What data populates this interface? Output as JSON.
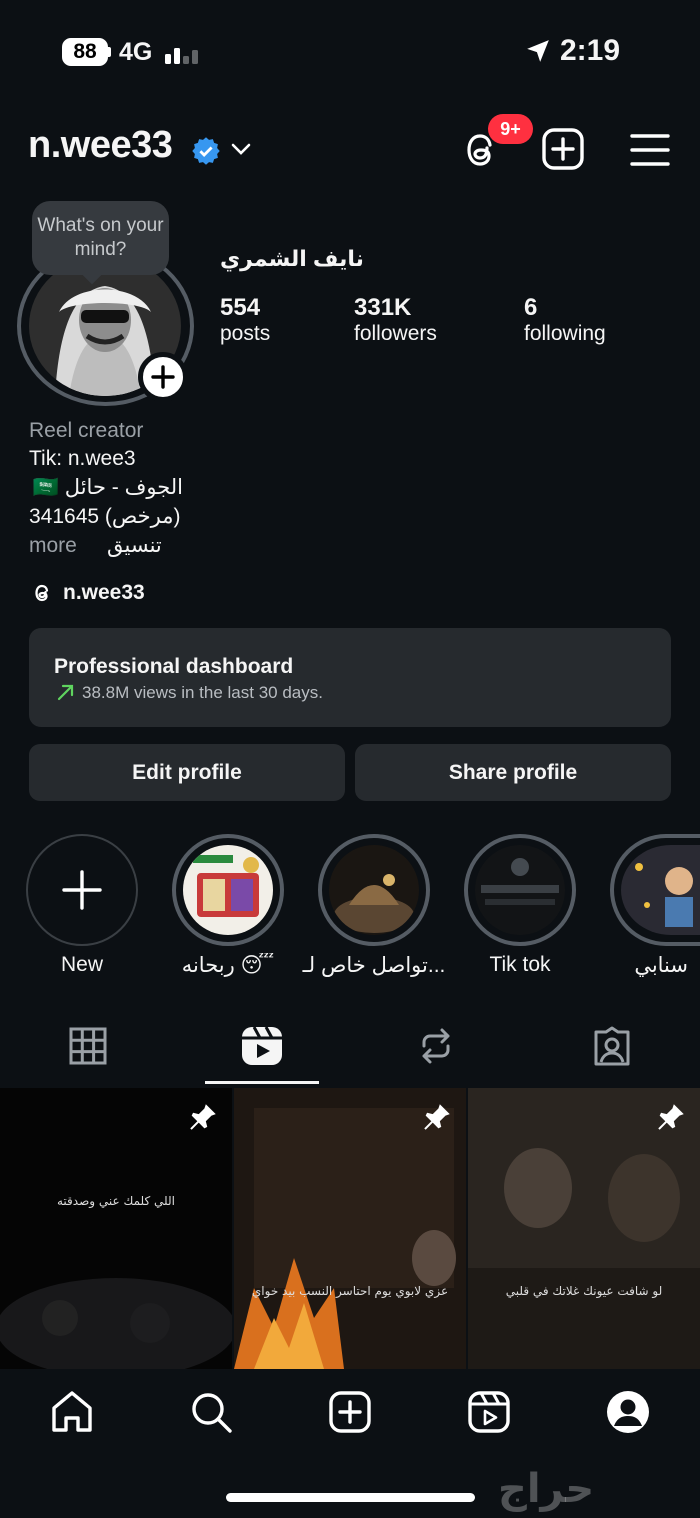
{
  "status_bar": {
    "battery": "88",
    "network": "4G",
    "time": "2:19"
  },
  "header": {
    "username": "n.wee33",
    "notification_badge": "9+"
  },
  "profile": {
    "note_bubble": "What's on your mind?",
    "full_name": "نايف الشمري",
    "stats": [
      {
        "value": "554",
        "label": "posts"
      },
      {
        "value": "331K",
        "label": "followers"
      },
      {
        "value": "6",
        "label": "following"
      }
    ],
    "category": "Reel creator",
    "bio_lines": [
      "Tik: n.wee3",
      "الجوف - حائل 🇸🇦",
      "341645 (مرخص)"
    ],
    "more_label": "more",
    "bio_extra": "تنسيق",
    "threads_handle": "n.wee33"
  },
  "dashboard": {
    "title": "Professional dashboard",
    "subtitle": "38.8M views in the last 30 days."
  },
  "actions": {
    "edit_label": "Edit profile",
    "share_label": "Share profile"
  },
  "highlights": [
    {
      "label": "New"
    },
    {
      "label": "ربحانه 😴"
    },
    {
      "label": "تواصل خاص لـ..."
    },
    {
      "label": "Tik tok"
    },
    {
      "label": "سنابي"
    }
  ],
  "reels": [
    {
      "caption": "اللي كلمك عني وصدقته"
    },
    {
      "caption": "عزي لابوي يوم احتاسر النسب بيد خواي"
    },
    {
      "caption": "لو شافت عيونك غلاتك في قلبي"
    }
  ],
  "watermark": "حراج",
  "colors": {
    "background": "#0c1014",
    "badge": "#ff3040",
    "verified": "#3797f0",
    "card": "#262a2e",
    "trend": "#5fd45f"
  }
}
